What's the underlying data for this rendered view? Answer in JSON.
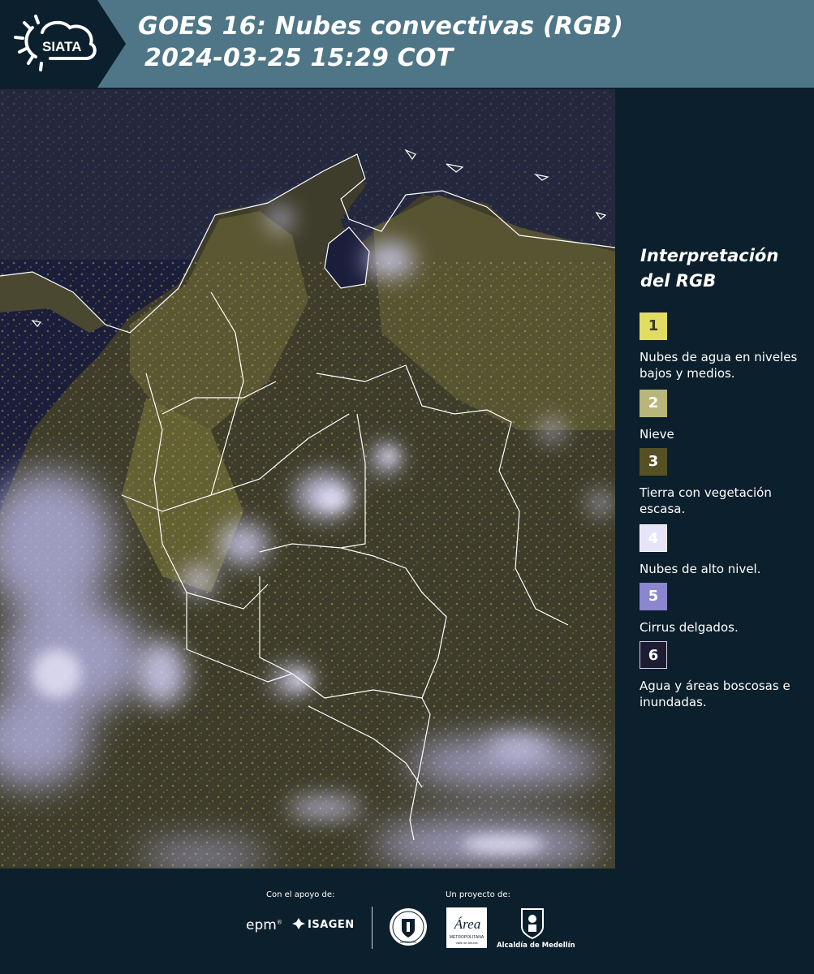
{
  "header": {
    "logo_text": "SIATA",
    "title_line1": "GOES 16: Nubes convectivas (RGB)",
    "title_line2": "2024-03-25 15:29 COT"
  },
  "map": {
    "icon": "satellite-rgb-map"
  },
  "legend": {
    "title": "Interpretación del RGB",
    "items": [
      {
        "number": "1",
        "label": "Nubes de agua en niveles bajos y medios.",
        "color": "#e1dc62",
        "text_color": "#3a3a20"
      },
      {
        "number": "2",
        "label": "Nieve",
        "color": "#b8b67a",
        "text_color": "#ffffff"
      },
      {
        "number": "3",
        "label": "Tierra con vegetación escasa.",
        "color": "#565124",
        "text_color": "#ffffff"
      },
      {
        "number": "4",
        "label": "Nubes de alto nivel.",
        "color": "#e6e4fb",
        "text_color": "#ffffff"
      },
      {
        "number": "5",
        "label": "Cirrus delgados.",
        "color": "#8c86cf",
        "text_color": "#ffffff"
      },
      {
        "number": "6",
        "label": "Agua y áreas boscosas e inundadas.",
        "color": "#1e1c32",
        "text_color": "#ffffff"
      }
    ]
  },
  "footer": {
    "support_label": "Con el apoyo de:",
    "project_label": "Un proyecto de:",
    "epm": "epm",
    "isagen": "ISAGEN",
    "area_logo_text": "Área",
    "area_sub1": "METROPOLITANA",
    "area_sub2": "Valle de Aburrá",
    "seal_text": "MEDELLÍN",
    "alcaldia": "Alcaldía de Medellín"
  },
  "colors": {
    "background": "#0c1f2c",
    "header_bar": "#4e7686",
    "map_base": "#1b1e3a"
  }
}
